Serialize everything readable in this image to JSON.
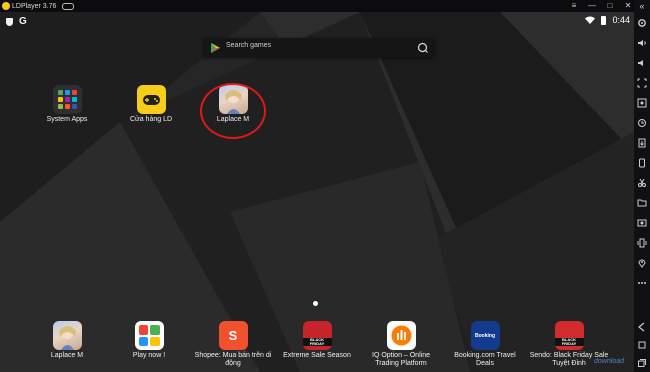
{
  "window": {
    "title": "LDPlayer 3.76",
    "buttons": {
      "menu": "≡",
      "minimize": "—",
      "maximize": "□",
      "close": "✕"
    },
    "collapse": "«"
  },
  "status_bar": {
    "left_letter": "G",
    "time": "0:44"
  },
  "search": {
    "placeholder": "Search games"
  },
  "desktop_apps": [
    {
      "label": "System Apps",
      "icon": "system-apps-icon"
    },
    {
      "label": "Cửa hàng LD",
      "icon": "gamepad-icon"
    },
    {
      "label": "Laplace M",
      "icon": "laplace-m-icon"
    }
  ],
  "dock_apps": [
    {
      "label": "Laplace M",
      "icon": "laplace-m-icon"
    },
    {
      "label": "Play now !",
      "icon": "play-now-icon"
    },
    {
      "label": "Shopee: Mua bán trên di động",
      "icon": "shopee-bag-icon",
      "badge": "S"
    },
    {
      "label": "Extreme Sale Season",
      "icon": "black-friday-icon",
      "badge": "BLACK FRIDAY"
    },
    {
      "label": "IQ Option – Online Trading Platform",
      "icon": "iq-option-icon"
    },
    {
      "label": "Booking.com Travel Deals",
      "icon": "booking-icon",
      "badge": "Booking"
    },
    {
      "label": "Sendo: Black Friday Sale Tuyệt Đỉnh",
      "icon": "sendo-icon",
      "badge": "BLACK FRIDAY"
    }
  ],
  "watermark": "download",
  "colors": {
    "highlight": "#e01818",
    "store_yellow": "#f7cd1a",
    "shopee": "#f2512e",
    "booking": "#133a8e",
    "black_friday": "#c5252b"
  }
}
